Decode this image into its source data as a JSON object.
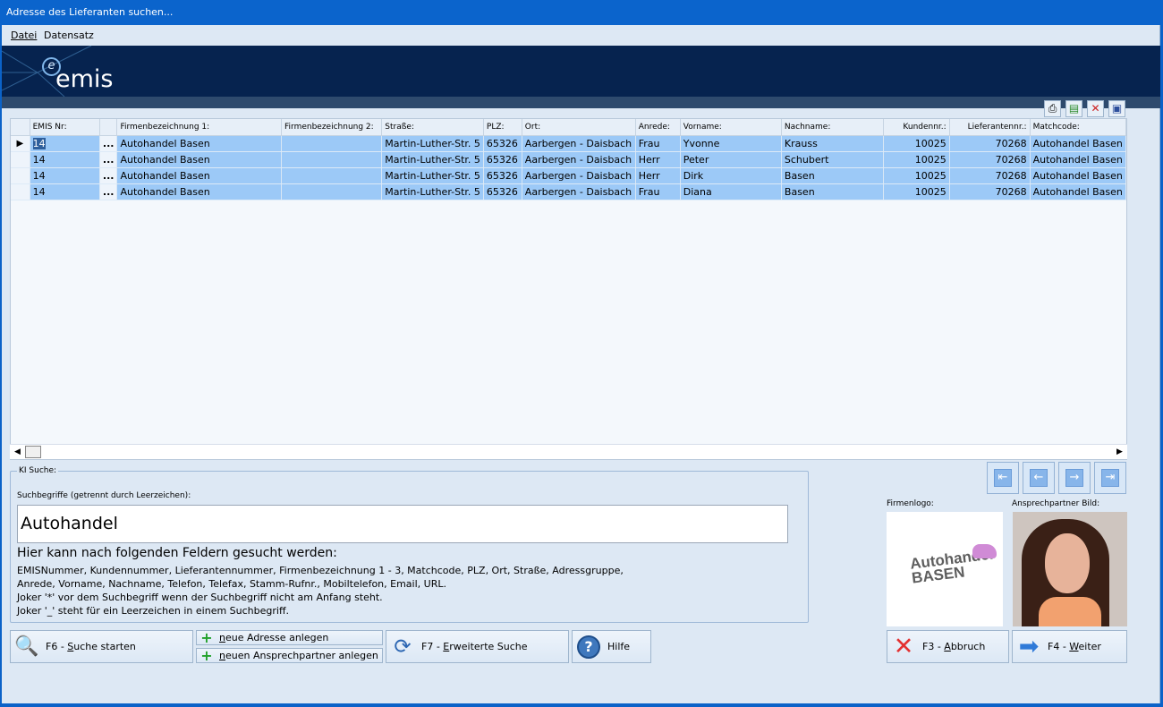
{
  "window": {
    "title": "Adresse des Lieferanten suchen..."
  },
  "menu": {
    "items": [
      "Datei",
      "Datensatz"
    ]
  },
  "brand": {
    "logo_text": "emis",
    "logo_mark": "e"
  },
  "grid": {
    "columns": [
      "EMIS Nr:",
      "",
      "Firmenbezeichnung 1:",
      "Firmenbezeichnung 2:",
      "Straße:",
      "PLZ:",
      "Ort:",
      "Anrede:",
      "Vorname:",
      "Nachname:",
      "Kundennr.:",
      "Lieferantennr.:",
      "Matchcode:"
    ],
    "rows": [
      {
        "emis": "14",
        "firma1": "Autohandel Basen",
        "firma2": "",
        "strasse": "Martin-Luther-Str. 5",
        "plz": "65326",
        "ort": "Aarbergen - Daisbach",
        "anrede": "Frau",
        "vorname": "Yvonne",
        "nachname": "Krauss",
        "kundennr": "10025",
        "lieferantennr": "70268",
        "matchcode": "Autohandel Basen"
      },
      {
        "emis": "14",
        "firma1": "Autohandel Basen",
        "firma2": "",
        "strasse": "Martin-Luther-Str. 5",
        "plz": "65326",
        "ort": "Aarbergen - Daisbach",
        "anrede": "Herr",
        "vorname": "Peter",
        "nachname": "Schubert",
        "kundennr": "10025",
        "lieferantennr": "70268",
        "matchcode": "Autohandel Basen"
      },
      {
        "emis": "14",
        "firma1": "Autohandel Basen",
        "firma2": "",
        "strasse": "Martin-Luther-Str. 5",
        "plz": "65326",
        "ort": "Aarbergen - Daisbach",
        "anrede": "Herr",
        "vorname": "Dirk",
        "nachname": "Basen",
        "kundennr": "10025",
        "lieferantennr": "70268",
        "matchcode": "Autohandel Basen"
      },
      {
        "emis": "14",
        "firma1": "Autohandel Basen",
        "firma2": "",
        "strasse": "Martin-Luther-Str. 5",
        "plz": "65326",
        "ort": "Aarbergen - Daisbach",
        "anrede": "Frau",
        "vorname": "Diana",
        "nachname": "Basen",
        "kundennr": "10025",
        "lieferantennr": "70268",
        "matchcode": "Autohandel Basen"
      }
    ],
    "row_action": "..."
  },
  "search": {
    "group_title": "KI Suche:",
    "field_label": "Suchbegriffe (getrennt durch Leerzeichen):",
    "value": "Autohandel",
    "info_title": "Hier kann nach folgenden Feldern gesucht werden:",
    "info_lines": [
      "EMISNummer, Kundennummer, Lieferantennummer, Firmenbezeichnung 1 - 3, Matchcode, PLZ, Ort, Straße, Adressgruppe,",
      "Anrede, Vorname, Nachname, Telefon, Telefax, Stamm-Rufnr., Mobiltelefon, Email, URL.",
      "Joker '*' vor dem Suchbegriff wenn der Suchbegriff nicht am Anfang steht.",
      "Joker '_' steht für ein Leerzeichen in einem Suchbegriff."
    ]
  },
  "buttons": {
    "search_pre": "F6 - ",
    "search_key": "S",
    "search_post": "uche starten",
    "new_address_key": "n",
    "new_address_post": "eue Adresse anlegen",
    "new_contact_key": "n",
    "new_contact_post": "euen Ansprechpartner anlegen",
    "ext_pre": "F7 - ",
    "ext_key": "E",
    "ext_post": "rweiterte Suche",
    "help": "Hilfe",
    "cancel_pre": "F3 - ",
    "cancel_key": "A",
    "cancel_post": "bbruch",
    "next_pre": "F4 - ",
    "next_key": "W",
    "next_post": "eiter"
  },
  "images": {
    "company_logo_label": "Firmenlogo:",
    "contact_photo_label": "Ansprechpartner Bild:",
    "company_logo_line1": "Autohandel",
    "company_logo_line2": "BASEN"
  }
}
